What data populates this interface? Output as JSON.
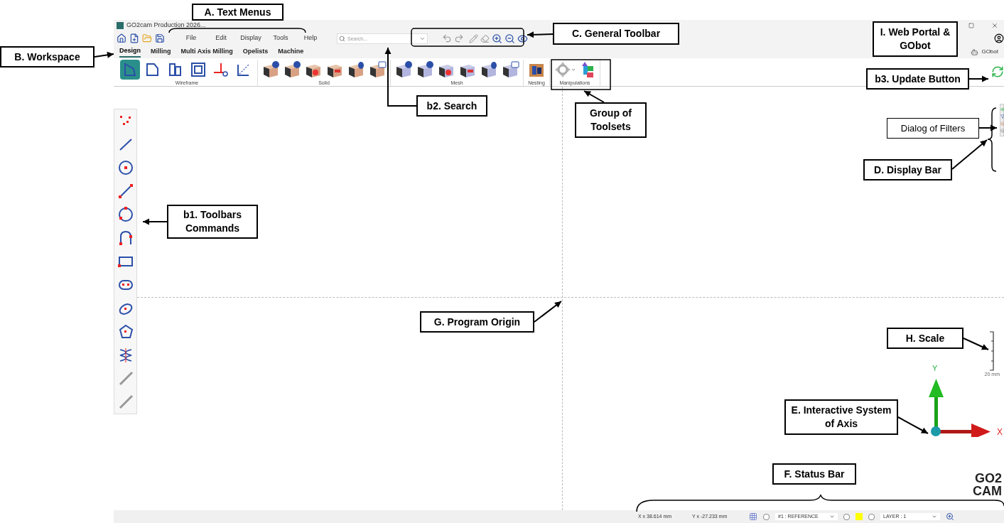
{
  "title_bar": {
    "title": "GO2cam Production 2026..."
  },
  "menus": [
    {
      "label": "File"
    },
    {
      "label": "Edit"
    },
    {
      "label": "Display"
    },
    {
      "label": "Tools"
    },
    {
      "label": "Help"
    }
  ],
  "search": {
    "placeholder": "Search..."
  },
  "workspace_tabs": [
    {
      "label": "Design",
      "selected": true
    },
    {
      "label": "Milling",
      "selected": false
    },
    {
      "label": "Multi Axis Milling",
      "selected": false
    },
    {
      "label": "Opelists",
      "selected": false
    },
    {
      "label": "Machine",
      "selected": false
    }
  ],
  "gobot": {
    "label": "GObot"
  },
  "ribbon_groups": [
    {
      "label": "Wireframe",
      "kind": "wireframe",
      "tools": [
        {
          "selected": true
        },
        {
          "selected": false
        },
        {
          "selected": false
        },
        {
          "selected": false
        },
        {
          "selected": false
        },
        {
          "selected": false
        }
      ]
    },
    {
      "label": "Solid",
      "kind": "solid"
    },
    {
      "label": "Mesh",
      "kind": "mesh"
    },
    {
      "label": "Nesting",
      "kind": "nesting"
    },
    {
      "label": "Manipulations",
      "kind": "manipulations"
    }
  ],
  "viewport": {
    "axis_x": "X",
    "axis_y": "Y",
    "scale_label": "20 mm",
    "logo_top": "GO2",
    "logo_bottom": "CAM"
  },
  "status_bar": {
    "x": "X x 38.614 mm",
    "y": "Y x -27.233 mm",
    "reference": "#1 : REFERENCE",
    "layer": "LAYER : 1",
    "toggles": [
      {
        "checked": false
      },
      {
        "checked": false
      },
      {
        "checked": false
      }
    ]
  },
  "annotations": [
    {
      "label": "A. Text Menus",
      "kind": "callout"
    },
    {
      "label": "B. Workspace",
      "kind": "callout"
    },
    {
      "label": "C. General Toolbar",
      "kind": "callout"
    },
    {
      "label": "I. Web Portal & GObot",
      "kind": "callout"
    },
    {
      "label": "b3. Update Button",
      "kind": "callout"
    },
    {
      "label": "b2. Search",
      "kind": "callout"
    },
    {
      "label": "Group of Toolsets",
      "kind": "callout"
    },
    {
      "label": "Dialog of Filters",
      "kind": "note"
    },
    {
      "label": "D. Display Bar",
      "kind": "callout"
    },
    {
      "label": "b1. Toolbars Commands",
      "kind": "callout"
    },
    {
      "label": "G. Program Origin",
      "kind": "callout"
    },
    {
      "label": "H. Scale",
      "kind": "callout"
    },
    {
      "label": "E. Interactive System of Axis",
      "kind": "callout"
    },
    {
      "label": "F. Status Bar",
      "kind": "callout"
    }
  ]
}
